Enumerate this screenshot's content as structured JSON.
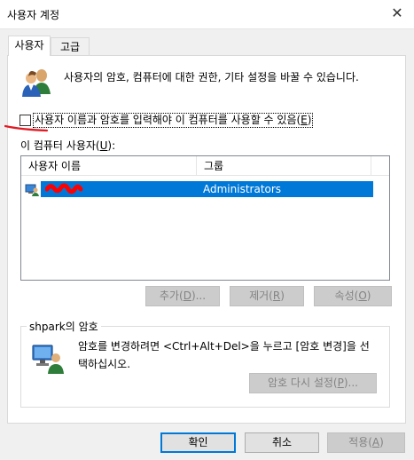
{
  "window": {
    "title": "사용자 계정",
    "close_glyph": "✕"
  },
  "tabs": [
    {
      "label": "사용자",
      "active": true
    },
    {
      "label": "고급",
      "active": false
    }
  ],
  "info_text": "사용자의 암호, 컴퓨터에 대한 권한, 기타 설정을 바꿀 수 있습니다.",
  "checkbox": {
    "label_before": "사용자 이름과 암호를 입력해야 이 컴퓨터를 사용할 수 있음(",
    "mnemonic": "E",
    "label_after": ")",
    "checked": false
  },
  "users_label": {
    "before": "이 컴퓨터 사용자(",
    "mnemonic": "U",
    "after": "):"
  },
  "list": {
    "columns": [
      "사용자 이름",
      "그룹"
    ],
    "rows": [
      {
        "name": "",
        "group": "Administrators",
        "selected": true
      }
    ]
  },
  "buttons": {
    "add": {
      "before": "추가(",
      "mnemonic": "D",
      "after": ")..."
    },
    "remove": {
      "before": "제거(",
      "mnemonic": "R",
      "after": ")"
    },
    "properties": {
      "before": "속성(",
      "mnemonic": "O",
      "after": ")"
    }
  },
  "password": {
    "legend": "shpark의 암호",
    "description": "암호를 변경하려면 <Ctrl+Alt+Del>을 누르고 [암호 변경]을 선택하십시오.",
    "reset_button": {
      "before": "암호 다시 설정(",
      "mnemonic": "P",
      "after": ")..."
    }
  },
  "dialog": {
    "ok": "확인",
    "cancel": "취소",
    "apply": {
      "before": "적용(",
      "mnemonic": "A",
      "after": ")"
    }
  },
  "colors": {
    "selection": "#0078d7",
    "annotation": "#e01b24",
    "redaction": "#ff0000"
  }
}
